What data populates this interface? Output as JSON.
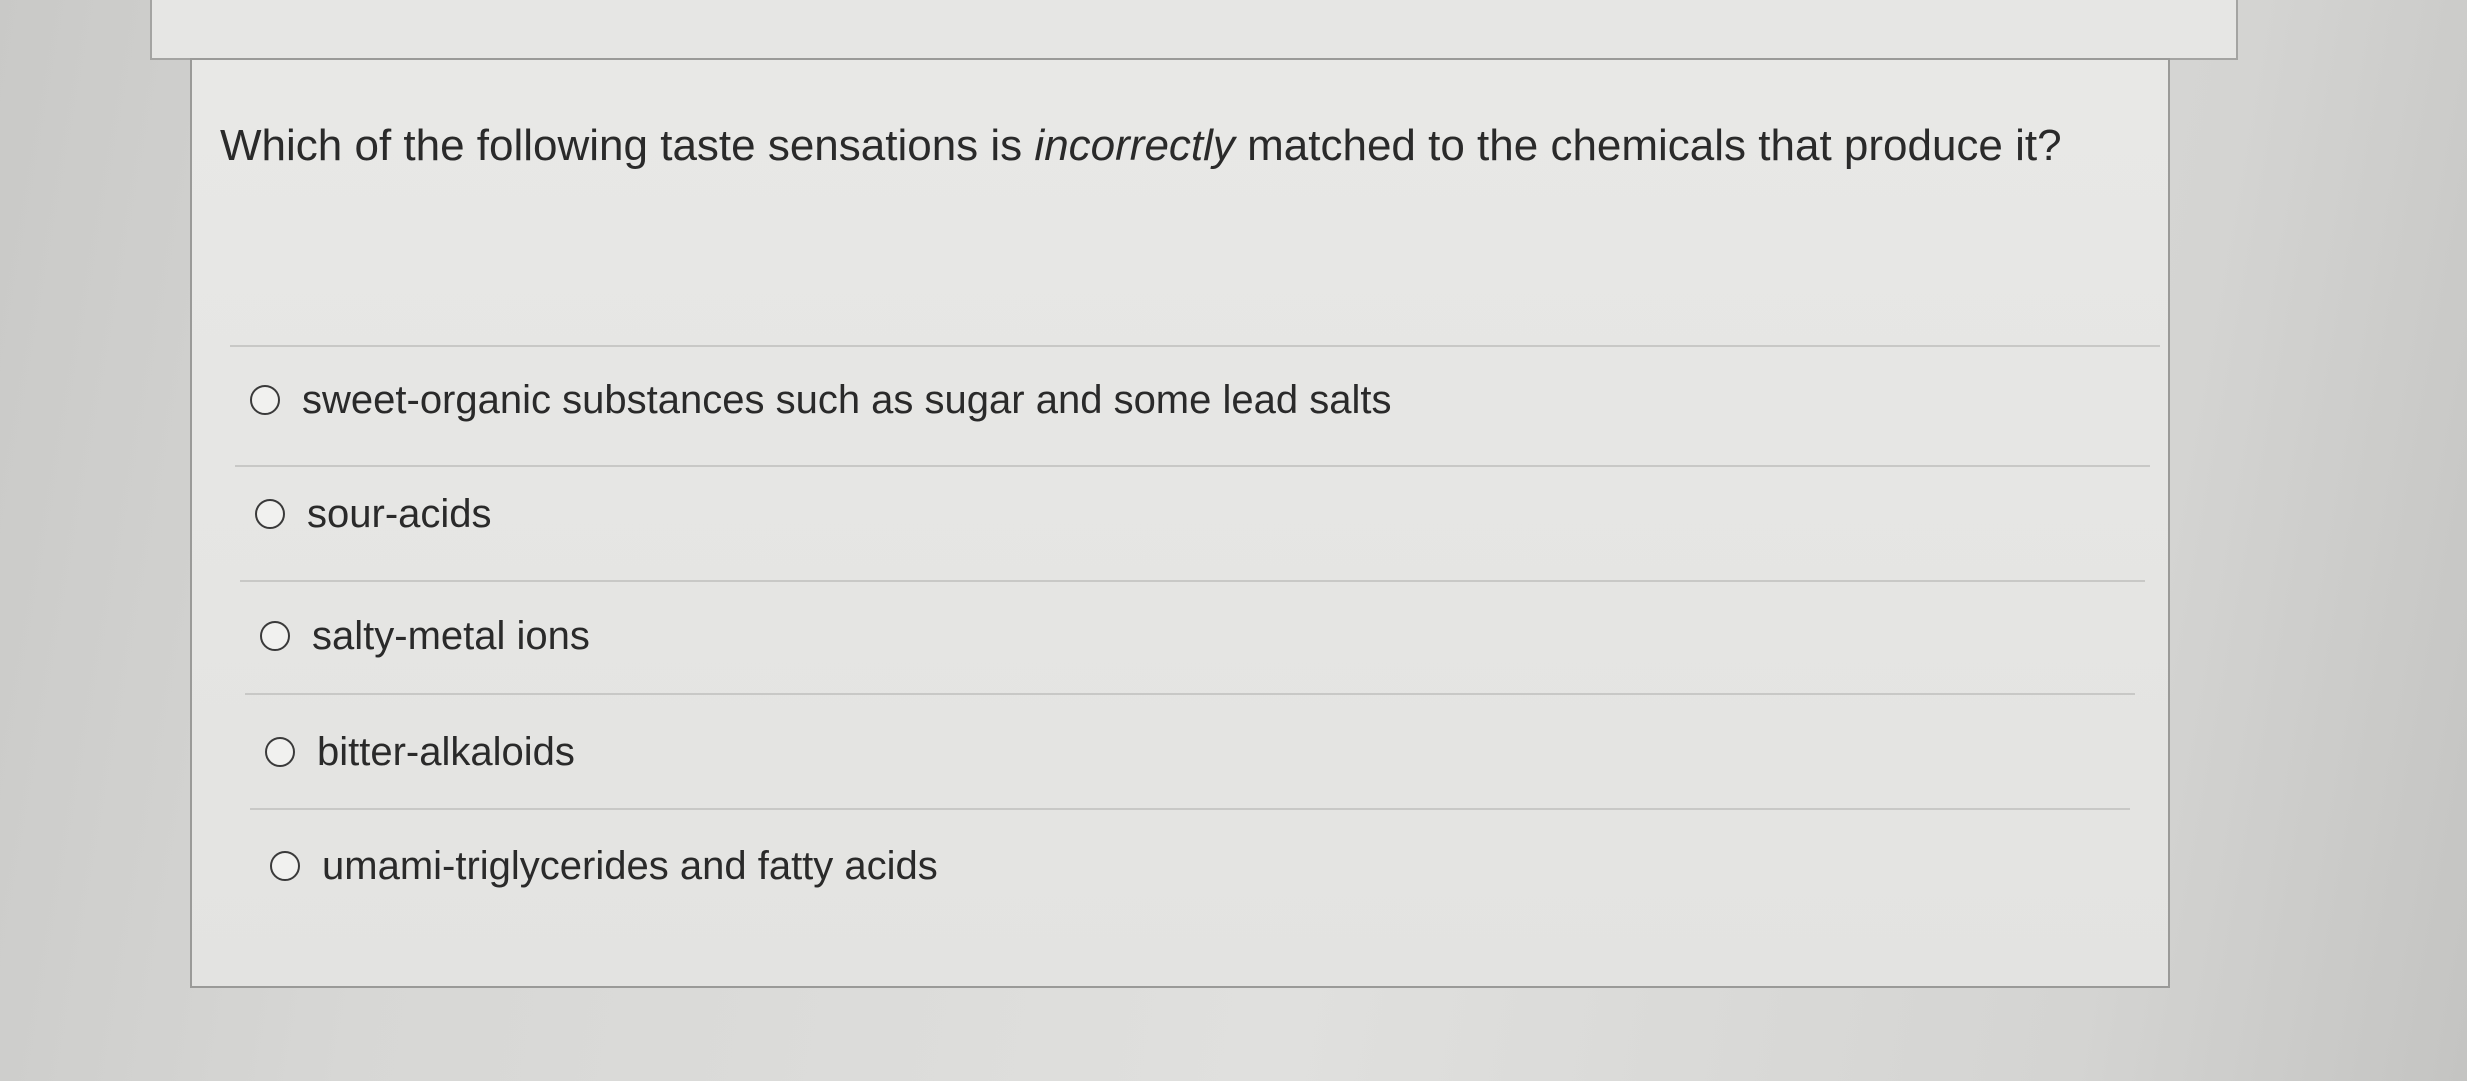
{
  "question": {
    "text_before": "Which of the following taste sensations is ",
    "emphasis": "incorrectly",
    "text_after": " matched to the chemicals that produce it?"
  },
  "options": [
    {
      "label": "sweet-organic substances such as sugar and some lead salts"
    },
    {
      "label": "sour-acids"
    },
    {
      "label": "salty-metal ions"
    },
    {
      "label": "bitter-alkaloids"
    },
    {
      "label": "umami-triglycerides and fatty acids"
    }
  ],
  "colors": {
    "background": "#d9d9d7",
    "card": "#e6e6e4",
    "border": "#9a9a98",
    "text": "#2a2a2a",
    "radio_border": "#3a3a3a"
  }
}
